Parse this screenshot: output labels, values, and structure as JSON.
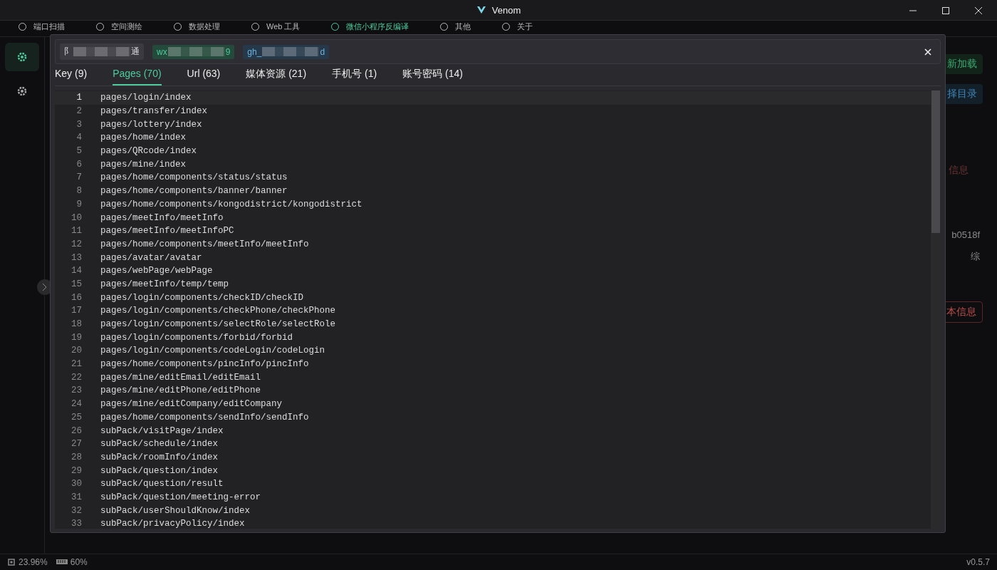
{
  "window": {
    "title": "Venom"
  },
  "nav": [
    {
      "label": "端口扫描",
      "selected": false
    },
    {
      "label": "空间测绘",
      "selected": false
    },
    {
      "label": "数据处理",
      "selected": false
    },
    {
      "label": "Web 工具",
      "selected": false
    },
    {
      "label": "微信小程序反编译",
      "selected": true
    },
    {
      "label": "其他",
      "selected": false
    },
    {
      "label": "关于",
      "selected": false
    }
  ],
  "sidebar": {
    "items": [
      {
        "selected": true
      },
      {
        "selected": false
      }
    ]
  },
  "background": [
    {
      "text": "新加载",
      "kind": "green"
    },
    {
      "text": "择目录",
      "kind": "blue"
    },
    {
      "text": "信息",
      "kind": "faded"
    },
    {
      "text": "b0518f",
      "kind": "muted"
    },
    {
      "text": "综",
      "kind": "muted"
    },
    {
      "text": "本信息",
      "kind": "red"
    }
  ],
  "modal": {
    "chips": [
      {
        "prefix": "阝",
        "suffix": "通",
        "kind": "gray"
      },
      {
        "prefix": "wx",
        "suffix": "9",
        "kind": "green"
      },
      {
        "prefix": "gh_",
        "suffix": "d",
        "kind": "blue"
      }
    ],
    "tabs": [
      {
        "label": "Key (9)",
        "selected": false
      },
      {
        "label": "Pages (70)",
        "selected": true
      },
      {
        "label": "Url (63)",
        "selected": false
      },
      {
        "label": "媒体资源 (21)",
        "selected": false
      },
      {
        "label": "手机号 (1)",
        "selected": false
      },
      {
        "label": "账号密码 (14)",
        "selected": false
      }
    ],
    "lines": [
      {
        "number": "1",
        "text": "pages/login/index",
        "current": true
      },
      {
        "number": "2",
        "text": "pages/transfer/index",
        "current": false
      },
      {
        "number": "3",
        "text": "pages/lottery/index",
        "current": false
      },
      {
        "number": "4",
        "text": "pages/home/index",
        "current": false
      },
      {
        "number": "5",
        "text": "pages/QRcode/index",
        "current": false
      },
      {
        "number": "6",
        "text": "pages/mine/index",
        "current": false
      },
      {
        "number": "7",
        "text": "pages/home/components/status/status",
        "current": false
      },
      {
        "number": "8",
        "text": "pages/home/components/banner/banner",
        "current": false
      },
      {
        "number": "9",
        "text": "pages/home/components/kongodistrict/kongodistrict",
        "current": false
      },
      {
        "number": "10",
        "text": "pages/meetInfo/meetInfo",
        "current": false
      },
      {
        "number": "11",
        "text": "pages/meetInfo/meetInfoPC",
        "current": false
      },
      {
        "number": "12",
        "text": "pages/home/components/meetInfo/meetInfo",
        "current": false
      },
      {
        "number": "13",
        "text": "pages/avatar/avatar",
        "current": false
      },
      {
        "number": "14",
        "text": "pages/webPage/webPage",
        "current": false
      },
      {
        "number": "15",
        "text": "pages/meetInfo/temp/temp",
        "current": false
      },
      {
        "number": "16",
        "text": "pages/login/components/checkID/checkID",
        "current": false
      },
      {
        "number": "17",
        "text": "pages/login/components/checkPhone/checkPhone",
        "current": false
      },
      {
        "number": "18",
        "text": "pages/login/components/selectRole/selectRole",
        "current": false
      },
      {
        "number": "19",
        "text": "pages/login/components/forbid/forbid",
        "current": false
      },
      {
        "number": "20",
        "text": "pages/login/components/codeLogin/codeLogin",
        "current": false
      },
      {
        "number": "21",
        "text": "pages/home/components/pincInfo/pincInfo",
        "current": false
      },
      {
        "number": "22",
        "text": "pages/mine/editEmail/editEmail",
        "current": false
      },
      {
        "number": "23",
        "text": "pages/mine/editPhone/editPhone",
        "current": false
      },
      {
        "number": "24",
        "text": "pages/mine/editCompany/editCompany",
        "current": false
      },
      {
        "number": "25",
        "text": "pages/home/components/sendInfo/sendInfo",
        "current": false
      },
      {
        "number": "26",
        "text": "subPack/visitPage/index",
        "current": false
      },
      {
        "number": "27",
        "text": "subPack/schedule/index",
        "current": false
      },
      {
        "number": "28",
        "text": "subPack/roomInfo/index",
        "current": false
      },
      {
        "number": "29",
        "text": "subPack/question/index",
        "current": false
      },
      {
        "number": "30",
        "text": "subPack/question/result",
        "current": false
      },
      {
        "number": "31",
        "text": "subPack/question/meeting-error",
        "current": false
      },
      {
        "number": "32",
        "text": "subPack/userShouldKnow/index",
        "current": false
      },
      {
        "number": "33",
        "text": "subPack/privacyPolicy/index",
        "current": false
      }
    ]
  },
  "status_bar": {
    "cpu": "23.96%",
    "memory": "60%",
    "version": "v0.5.7"
  }
}
